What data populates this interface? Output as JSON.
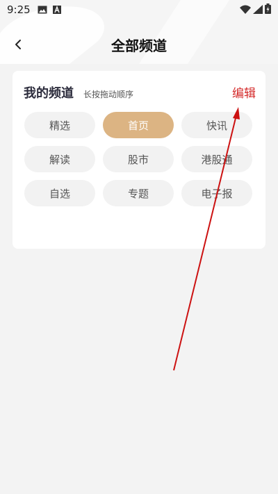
{
  "status_bar": {
    "time": "9:25",
    "icons": [
      "image-icon",
      "text-a-icon",
      "wifi-icon",
      "signal-icon",
      "battery-icon"
    ]
  },
  "header": {
    "title": "全部频道",
    "back_icon": "chevron-left-icon"
  },
  "my_channels": {
    "title": "我的频道",
    "hint": "长按拖动顺序",
    "edit_label": "编辑",
    "items": [
      {
        "label": "精选",
        "active": false
      },
      {
        "label": "首页",
        "active": true
      },
      {
        "label": "快讯",
        "active": false
      },
      {
        "label": "解读",
        "active": false
      },
      {
        "label": "股市",
        "active": false
      },
      {
        "label": "港股通",
        "active": false
      },
      {
        "label": "自选",
        "active": false
      },
      {
        "label": "专题",
        "active": false
      },
      {
        "label": "电子报",
        "active": false
      }
    ]
  },
  "colors": {
    "accent_edit": "#d42a2a",
    "active_chip": "#dcb483",
    "annotation_arrow": "#cc1111"
  }
}
